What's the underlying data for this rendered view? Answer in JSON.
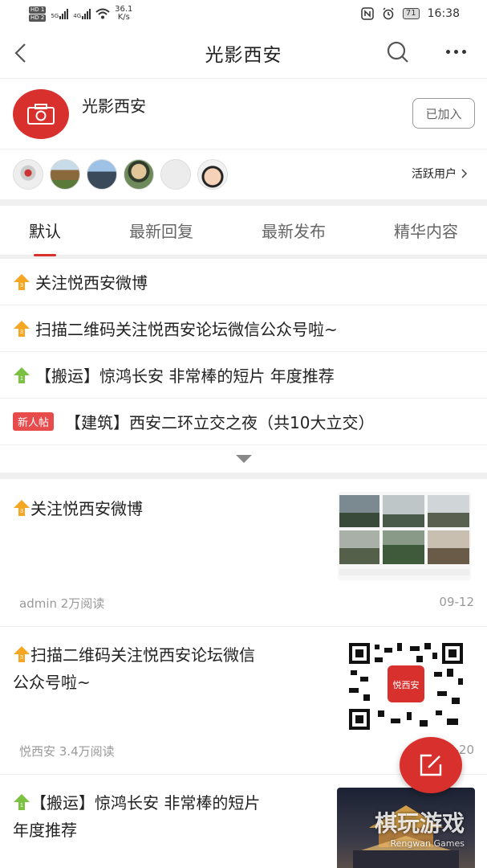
{
  "status_bar": {
    "hd1": "HD 1",
    "hd2": "HD 2",
    "sig1": "5G",
    "sig2": "4G",
    "speed_value": "36.1",
    "speed_unit": "K/s",
    "battery": "71",
    "time": "16:38"
  },
  "header": {
    "title": "光影西安"
  },
  "group": {
    "name": "光影西安",
    "join_label": "已加入"
  },
  "active_users": {
    "link_label": "活跃用户"
  },
  "tabs": [
    "默认",
    "最新回复",
    "最新发布",
    "精华内容"
  ],
  "pinned": [
    {
      "badge": "3",
      "title": "关注悦西安微博"
    },
    {
      "badge": "3",
      "title": "扫描二维码关注悦西安论坛微信公众号啦~"
    },
    {
      "badge": "1",
      "title": "【搬运】惊鸿长安 非常棒的短片 年度推荐"
    },
    {
      "tag": "新人帖",
      "title": "【建筑】西安二环立交之夜（共10大立交）"
    }
  ],
  "feed": [
    {
      "badge": "3",
      "title": "关注悦西安微博",
      "meta": "admin 2万阅读",
      "date": "09-12"
    },
    {
      "badge": "3",
      "title_line1": "扫描二维码关注悦西安论坛微信",
      "title_line2": "公众号啦~",
      "meta": "悦西安 3.4万阅读",
      "date": "07-20",
      "qr_label": "悦西安"
    },
    {
      "badge": "1",
      "title_line1": "【搬运】惊鸿长安 非常棒的短片",
      "title_line2": "年度推荐"
    }
  ],
  "watermark": {
    "main": "棋玩游戏",
    "sub": "Rengwan Games"
  },
  "colors": {
    "accent": "#d8302c",
    "pin_orange": "#f5a623",
    "pin_green": "#7cc242"
  }
}
